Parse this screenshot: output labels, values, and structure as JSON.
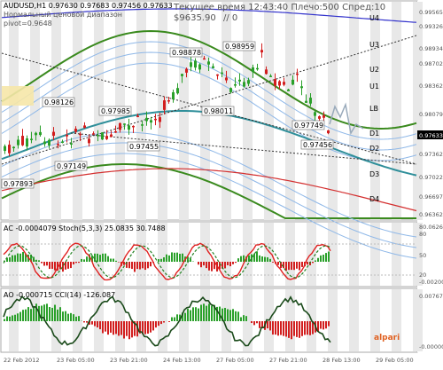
{
  "header": {
    "symbol_line": "AUDUSD,H1  0.97630 0.97683 0.97456 0.97633",
    "sub1": "Нормальный ценовой диапазон",
    "sub2": "pivot=0.9648",
    "server_time": "Текущее время 12:43:40 Плечо:500 Спред:10",
    "balance": "$9635.90",
    "counter": "// 0"
  },
  "main_chart": {
    "price_labels": [
      "0.99565",
      "0.99326",
      "0.98934",
      "0.98702",
      "0.98362",
      "0.98079",
      "0.97633",
      "0.97362",
      "0.97022",
      "0.96697",
      "0.96362"
    ],
    "level_labels": [
      "U4",
      "U3",
      "U2",
      "U1",
      "LB",
      "D1",
      "D2",
      "D3",
      "D4"
    ],
    "annotations": [
      "0.98126",
      "0.97985",
      "0.98878",
      "0.98959",
      "0.98011",
      "0.97749",
      "0.97455",
      "0.97456",
      "0.97149",
      "0.97893"
    ],
    "current_price": "0.97633"
  },
  "ac_panel": {
    "title": "AC -0.0004079  Stoch(5,3,3) 25.0835 30.7488",
    "scale": [
      "80.0626",
      "80",
      "50",
      "20",
      "-0.00200"
    ]
  },
  "ao_panel": {
    "title": "AO -0.000715  CCI(14) -126.087",
    "scale": [
      "0.007675",
      "-0.00000"
    ],
    "brand": "alpari"
  },
  "time_axis": {
    "labels": [
      "22 Feb 2012",
      "23 Feb 05:00",
      "23 Feb 21:00",
      "24 Feb 13:00",
      "27 Feb 05:00",
      "27 Feb 21:00",
      "28 Feb 13:00",
      "29 Feb 05:00"
    ]
  },
  "colors": {
    "bull": "#2aa02a",
    "bear": "#d21e1e",
    "channel_outer": "#3a8a1e",
    "channel_inner": "#8fb8e8",
    "mid": "#2f8f9a",
    "resistance": "#3333cc",
    "support": "#d43030",
    "grid_band": "#e8e8e8",
    "price_tag": "#000000"
  }
}
